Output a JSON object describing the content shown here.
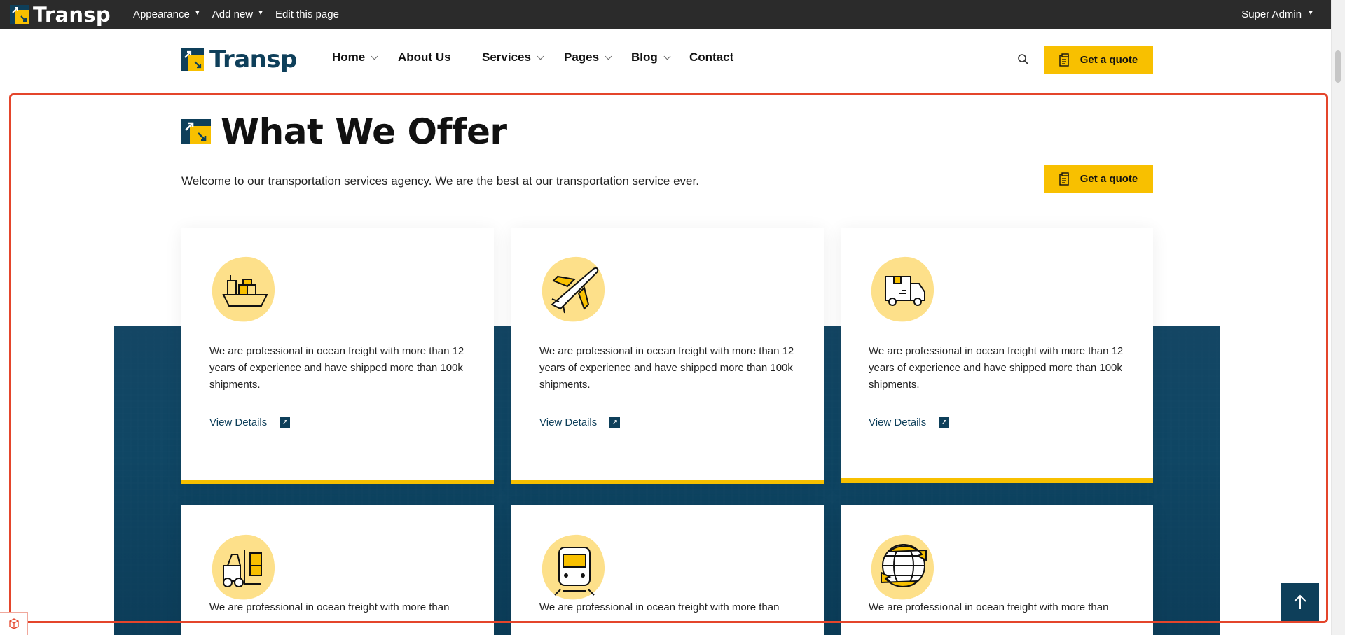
{
  "admin_bar": {
    "brand": "Transp",
    "menu": [
      {
        "label": "Appearance",
        "has_caret": true
      },
      {
        "label": "Add new",
        "has_caret": true
      },
      {
        "label": "Edit this page",
        "has_caret": false
      }
    ],
    "user": "Super Admin"
  },
  "header": {
    "brand": "Transp",
    "nav": [
      {
        "label": "Home",
        "has_dropdown": true
      },
      {
        "label": "About Us",
        "has_dropdown": false
      },
      {
        "label": "Services",
        "has_dropdown": true
      },
      {
        "label": "Pages",
        "has_dropdown": true
      },
      {
        "label": "Blog",
        "has_dropdown": true
      },
      {
        "label": "Contact",
        "has_dropdown": false
      }
    ],
    "search_icon": "search-icon",
    "quote_button": "Get a quote"
  },
  "section": {
    "title": "What We Offer",
    "subtitle": "Welcome to our transportation services agency. We are the best at our transportation service ever.",
    "quote_button": "Get a quote",
    "cards": [
      {
        "icon": "cargo-ship-icon",
        "description": "We are professional in ocean freight with more than 12 years of experience and have shipped more than 100k shipments.",
        "link": "View Details"
      },
      {
        "icon": "airplane-icon",
        "description": "We are professional in ocean freight with more than 12 years of experience and have shipped more than 100k shipments.",
        "link": "View Details"
      },
      {
        "icon": "delivery-truck-icon",
        "description": "We are professional in ocean freight with more than 12 years of experience and have shipped more than 100k shipments.",
        "link": "View Details"
      },
      {
        "icon": "forklift-icon",
        "description": "We are professional in ocean freight with more than",
        "link": ""
      },
      {
        "icon": "train-icon",
        "description": "We are professional in ocean freight with more than",
        "link": ""
      },
      {
        "icon": "globe-arrows-icon",
        "description": "We are professional in ocean freight with more than",
        "link": ""
      }
    ]
  },
  "colors": {
    "accent": "#f8c000",
    "brand": "#0e3f5a",
    "admin_bar": "#2b2b2b",
    "highlight": "#e4452b"
  }
}
